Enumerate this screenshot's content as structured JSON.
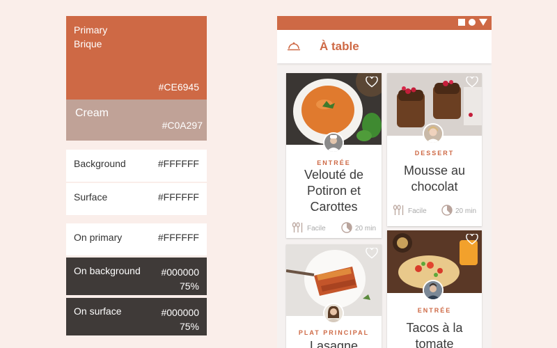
{
  "palette": {
    "primary": {
      "name_line1": "Primary",
      "name_line2": "Brique",
      "hex": "#CE6945"
    },
    "cream": {
      "name": "Cream",
      "hex": "#C0A297"
    },
    "background": {
      "name": "Background",
      "hex": "#FFFFFF"
    },
    "surface": {
      "name": "Surface",
      "hex": "#FFFFFF"
    },
    "on_primary": {
      "name": "On primary",
      "hex": "#FFFFFF"
    },
    "on_background": {
      "name": "On background",
      "hex": "#000000",
      "opacity": "75%"
    },
    "on_surface": {
      "name": "On surface",
      "hex": "#000000",
      "opacity": "75%"
    }
  },
  "app": {
    "title": "À table",
    "menu_icon": "cloche-icon"
  },
  "recipes": [
    {
      "category": "ENTRÉE",
      "title": "Velouté de Potiron et Carottes",
      "difficulty": "Facile",
      "time": "20 min"
    },
    {
      "category": "DESSERT",
      "title": "Mousse au chocolat",
      "difficulty": "Facile",
      "time": "20 min"
    },
    {
      "category": "PLAT PRINCIPAL",
      "title": "Lasagne"
    },
    {
      "category": "ENTRÉE",
      "title": "Tacos à la tomate"
    }
  ],
  "colors": {
    "primary": "#CE6945",
    "cream": "#C0A297",
    "page_background": "#FAEEEA",
    "dark": "#3F3A38"
  }
}
